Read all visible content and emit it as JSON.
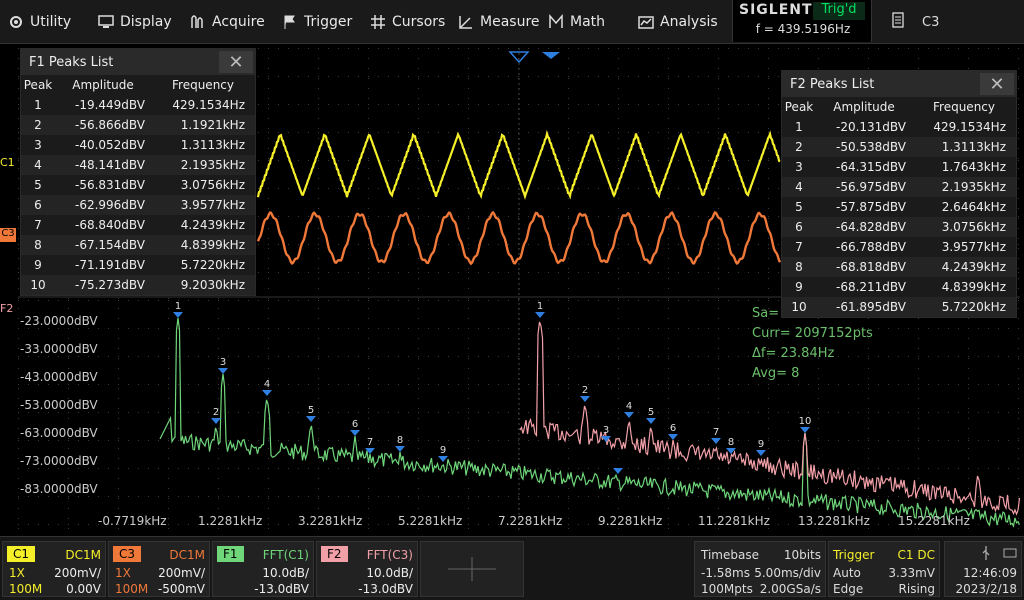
{
  "menu": {
    "utility": "Utility",
    "display": "Display",
    "acquire": "Acquire",
    "trigger": "Trigger",
    "cursors": "Cursors",
    "measure": "Measure",
    "math": "Math",
    "analysis": "Analysis"
  },
  "brand": {
    "name": "SIGLENT",
    "trig_state": "Trig'd",
    "frequency": "f = 439.5196Hz"
  },
  "channel_selector": "C3",
  "markers": {
    "c1": "C1",
    "c3": "C3",
    "f2": "F2"
  },
  "f1_table": {
    "title": "F1 Peaks List",
    "headers": [
      "Peak",
      "Amplitude",
      "Frequency"
    ],
    "rows": [
      [
        "1",
        "-19.449dBV",
        "429.1534Hz"
      ],
      [
        "2",
        "-56.866dBV",
        "1.1921kHz"
      ],
      [
        "3",
        "-40.052dBV",
        "1.3113kHz"
      ],
      [
        "4",
        "-48.141dBV",
        "2.1935kHz"
      ],
      [
        "5",
        "-56.831dBV",
        "3.0756kHz"
      ],
      [
        "6",
        "-62.996dBV",
        "3.9577kHz"
      ],
      [
        "7",
        "-68.840dBV",
        "4.2439kHz"
      ],
      [
        "8",
        "-67.154dBV",
        "4.8399kHz"
      ],
      [
        "9",
        "-71.191dBV",
        "5.7220kHz"
      ],
      [
        "10",
        "-75.273dBV",
        "9.2030kHz"
      ]
    ]
  },
  "f2_table": {
    "title": "F2 Peaks List",
    "headers": [
      "Peak",
      "Amplitude",
      "Frequency"
    ],
    "rows": [
      [
        "1",
        "-20.131dBV",
        "429.1534Hz"
      ],
      [
        "2",
        "-50.538dBV",
        "1.3113kHz"
      ],
      [
        "3",
        "-64.315dBV",
        "1.7643kHz"
      ],
      [
        "4",
        "-56.975dBV",
        "2.1935kHz"
      ],
      [
        "5",
        "-57.875dBV",
        "2.6464kHz"
      ],
      [
        "6",
        "-64.828dBV",
        "3.0756kHz"
      ],
      [
        "7",
        "-66.788dBV",
        "3.9577kHz"
      ],
      [
        "8",
        "-68.818dBV",
        "4.2439kHz"
      ],
      [
        "9",
        "-68.211dBV",
        "4.8399kHz"
      ],
      [
        "10",
        "-61.895dBV",
        "5.7220kHz"
      ]
    ]
  },
  "fft_axis": {
    "y_labels": [
      "-23.0000dBV",
      "-33.0000dBV",
      "-43.0000dBV",
      "-53.0000dBV",
      "-63.0000dBV",
      "-73.0000dBV",
      "-83.0000dBV"
    ],
    "x_labels": [
      "-0.7719kHz",
      "1.2281kHz",
      "3.2281kHz",
      "5.2281kHz",
      "7.2281kHz",
      "9.2281kHz",
      "11.2281kHz",
      "13.2281kHz",
      "15.2281kHz"
    ]
  },
  "readout": {
    "sa": "Sa=",
    "curr": "Curr= 2097152pts",
    "df": "Δf=  23.84Hz",
    "avg": "Avg= 8"
  },
  "status": {
    "c1": {
      "tag": "C1",
      "coupling": "DC1M",
      "probe": "1X",
      "scale": "200mV/",
      "bw": "100M",
      "offset": "0.00V"
    },
    "c3": {
      "tag": "C3",
      "coupling": "DC1M",
      "probe": "1X",
      "scale": "200mV/",
      "bw": "100M",
      "offset": "-500mV"
    },
    "f1": {
      "tag": "F1",
      "func": "FFT(C1)",
      "scale": "10.0dB/",
      "offset": "-13.0dBV"
    },
    "f2": {
      "tag": "F2",
      "func": "FFT(C3)",
      "scale": "10.0dB/",
      "offset": "-13.0dBV"
    },
    "timebase": {
      "label": "Timebase",
      "bits": "10bits",
      "delay": "-1.58ms",
      "scale": "5.00ms/div",
      "memory": "100Mpts",
      "rate": "2.00GSa/s"
    },
    "trigger": {
      "label": "Trigger",
      "source": "C1 DC",
      "mode": "Auto",
      "level": "3.33mV",
      "type": "Edge",
      "slope": "Rising"
    },
    "clock": {
      "time": "12:46:09",
      "date": "2023/2/18"
    }
  },
  "colors": {
    "c1": "#f5ef2a",
    "c3": "#f07838",
    "f1": "#6fd67a",
    "f2": "#f2a0a8",
    "marker": "#2f7fe0"
  }
}
